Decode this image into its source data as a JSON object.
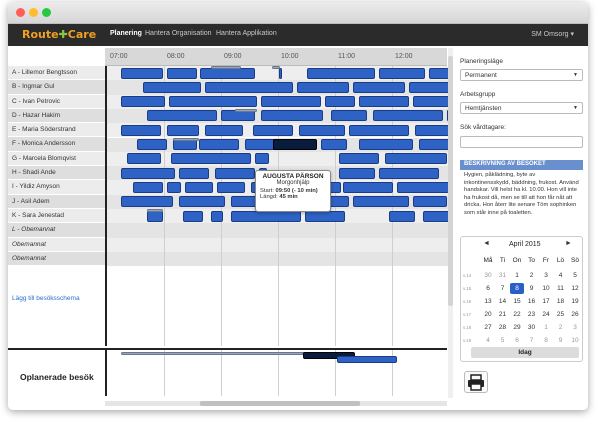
{
  "titlebar": {
    "colors": {
      "close": "#ff5f57",
      "minimize": "#febc2e",
      "zoom": "#28c840"
    }
  },
  "navbar": {
    "brand_left": "Route",
    "brand_right": "Care",
    "tabs": [
      {
        "label": "Planering",
        "active": true
      },
      {
        "label": "Hantera Organisation",
        "active": false
      },
      {
        "label": "Hantera Applikation",
        "active": false
      }
    ],
    "user_label": "SM Omsorg ▾"
  },
  "timeline": {
    "hours": [
      "07:00",
      "08:00",
      "09:00",
      "10:00",
      "11:00",
      "12:00"
    ]
  },
  "staff": [
    {
      "label": "A - Lillemor Bengtsson",
      "italic": false
    },
    {
      "label": "B - Ingmar Gul",
      "italic": false
    },
    {
      "label": "C - Ivan Petrovic",
      "italic": false
    },
    {
      "label": "D - Hazar Hakim",
      "italic": false
    },
    {
      "label": "E - Maria Söderstrand",
      "italic": false
    },
    {
      "label": "F - Monica Andersson",
      "italic": false
    },
    {
      "label": "G - Marcela Blomqvist",
      "italic": false
    },
    {
      "label": "H - Shadi Ande",
      "italic": false
    },
    {
      "label": "I - Yildiz Amyson",
      "italic": false
    },
    {
      "label": "J - Asil Adem",
      "italic": false
    },
    {
      "label": "K - Sara Jenestad",
      "italic": false
    },
    {
      "label": "L - Obemannat",
      "italic": true
    },
    {
      "label": "Obemannat",
      "italic": true
    },
    {
      "label": "Obemannat",
      "italic": true
    }
  ],
  "add_schedule_link": "Lägg till besöksschema",
  "tooltip": {
    "name": "AUGUSTA PÄRSON",
    "service": "Morgonhjälp",
    "start_label": "Start:",
    "start_value": "09:50 (- 10 min)",
    "length_label": "Längd:",
    "length_value": "45 min"
  },
  "unplanned_label": "Oplanerade besök",
  "sidebar": {
    "planning_mode_label": "Planeringsläge",
    "planning_mode_value": "Permanent",
    "workgroup_label": "Arbetsgrupp",
    "workgroup_value": "Hemtjänsten",
    "search_label": "Sök vårdtagare:",
    "description_header": "BESKRIVNING AV BESÖKET",
    "description_text": "Hygien, påklädning, byte av inkontinensskydd, bäddning, frukost. Använd handskar. Vill helst ha kl. 10.00. Hon vill inte ha frukost då, men se till att hon får nåt att dricka. Hon återr lite senare Töm sophinken som står inne på toaletten."
  },
  "calendar": {
    "month_label": "April 2015",
    "prev": "◄",
    "next": "►",
    "weekdays": [
      "Må",
      "Ti",
      "On",
      "To",
      "Fr",
      "Lö",
      "Sö"
    ],
    "week_numbers": [
      "v.14",
      "v.15",
      "v.16",
      "v.17",
      "v.18",
      "v.19"
    ],
    "weeks": [
      [
        "30",
        "31",
        "1",
        "2",
        "3",
        "4",
        "5"
      ],
      [
        "6",
        "7",
        "8",
        "9",
        "10",
        "11",
        "12"
      ],
      [
        "13",
        "14",
        "15",
        "16",
        "17",
        "18",
        "19"
      ],
      [
        "20",
        "21",
        "22",
        "23",
        "24",
        "25",
        "26"
      ],
      [
        "27",
        "28",
        "29",
        "30",
        "1",
        "2",
        "3"
      ],
      [
        "4",
        "5",
        "6",
        "7",
        "8",
        "9",
        "10"
      ]
    ],
    "selected_day": "8",
    "today_label": "Idag"
  },
  "print_icon": "printer-icon"
}
